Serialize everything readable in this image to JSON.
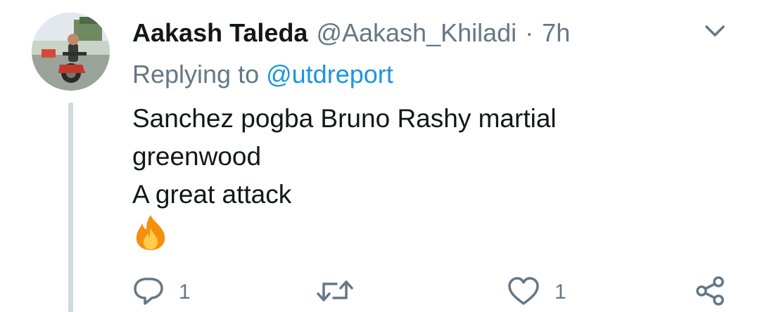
{
  "tweet": {
    "display_name": "Aakash Taleda",
    "handle": "@Aakash_Khiladi",
    "separator": "·",
    "time": "7h",
    "replying_prefix": "Replying to ",
    "replying_to": "@utdreport",
    "body_lines": [
      "Sanchez pogba Bruno Rashy martial",
      "greenwood",
      "A great attack"
    ],
    "emoji": "fire"
  },
  "actions": {
    "reply_count": "1",
    "retweet_count": "",
    "like_count": "1",
    "share_count": ""
  },
  "icons": [
    "chevron-down-icon",
    "reply-icon",
    "retweet-icon",
    "like-icon",
    "share-icon",
    "fire-emoji-icon"
  ],
  "colors": {
    "text_primary": "#14171a",
    "text_secondary": "#657786",
    "link": "#1b95e0",
    "thread_line": "#cfd9de"
  }
}
